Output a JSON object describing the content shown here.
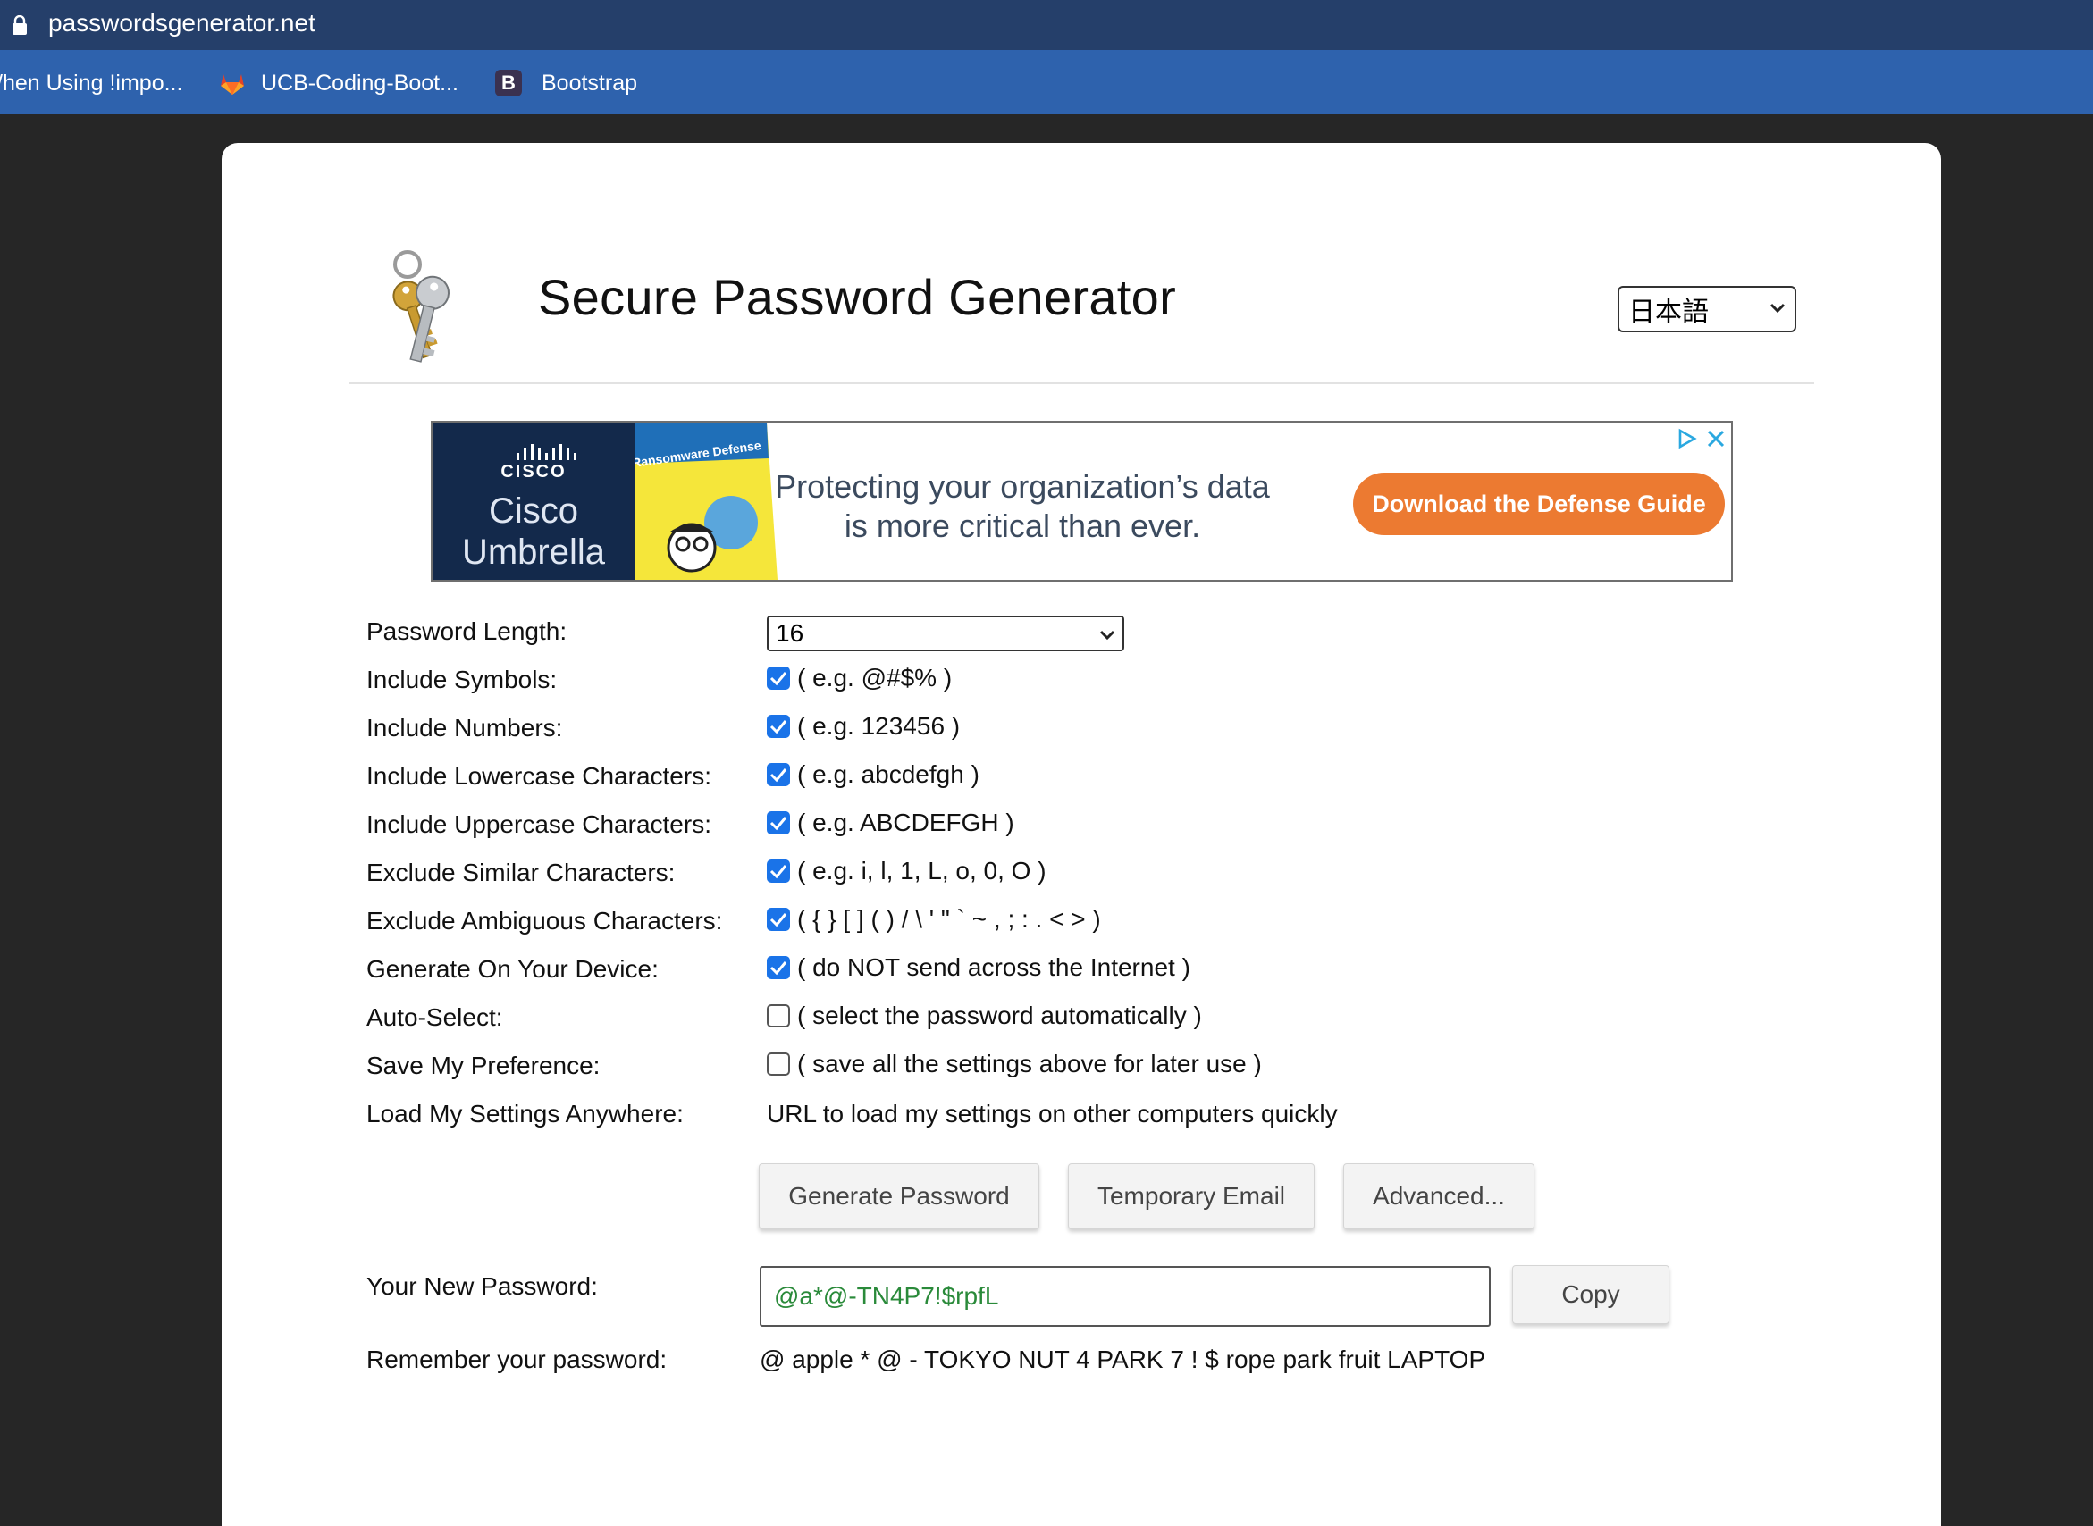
{
  "browser": {
    "url": "passwordsgenerator.net",
    "bookmarks": [
      {
        "label": "/hen Using !impo...",
        "icon": "none"
      },
      {
        "label": "UCB-Coding-Boot...",
        "icon": "gitlab-icon"
      },
      {
        "label": "Bootstrap",
        "icon": "bootstrap-icon",
        "icon_letter": "B"
      }
    ]
  },
  "header": {
    "title": "Secure Password Generator",
    "language": "日本語",
    "logo_icon": "keys-icon"
  },
  "ad": {
    "brand": "CISCO",
    "product": "Cisco Umbrella",
    "book_title": "Ransomware Defense",
    "text": "Protecting your organization’s data is more critical than ever.",
    "cta": "Download the Defense Guide",
    "brand_color": "#13294b",
    "cta_color": "#ec7a31"
  },
  "form": {
    "length_label": "Password Length:",
    "length_value": "16",
    "options": [
      {
        "label": "Include Symbols:",
        "desc": "( e.g. @#$% )",
        "checked": true
      },
      {
        "label": "Include Numbers:",
        "desc": "( e.g. 123456 )",
        "checked": true
      },
      {
        "label": "Include Lowercase Characters:",
        "desc": "( e.g. abcdefgh )",
        "checked": true
      },
      {
        "label": "Include Uppercase Characters:",
        "desc": "( e.g. ABCDEFGH )",
        "checked": true
      },
      {
        "label": "Exclude Similar Characters:",
        "desc": "( e.g. i, l, 1, L, o, 0, O )",
        "checked": true
      },
      {
        "label": "Exclude Ambiguous Characters:",
        "desc": "( { } [ ] ( ) / \\ ' \" ` ~ , ; : . < > )",
        "checked": true
      },
      {
        "label": "Generate On Your Device:",
        "desc": "( do NOT send across the Internet )",
        "checked": true
      },
      {
        "label": "Auto-Select:",
        "desc": "( select the password automatically )",
        "checked": false
      },
      {
        "label": "Save My Preference:",
        "desc": "( save all the settings above for later use )",
        "checked": false
      }
    ],
    "load_label": "Load My Settings Anywhere:",
    "load_link": "URL to load my settings on other computers quickly",
    "buttons": {
      "generate": "Generate Password",
      "temp_email": "Temporary Email",
      "advanced": "Advanced..."
    },
    "new_password_label": "Your New Password:",
    "new_password": "@a*@-TN4P7!$rpfL",
    "copy": "Copy",
    "remember_label": "Remember your password:",
    "remember_value": "@ apple * @ - TOKYO NUT 4 PARK 7 ! $ rope park fruit LAPTOP",
    "accent_color": "#1a73e8",
    "password_color": "#2a8a3a"
  }
}
